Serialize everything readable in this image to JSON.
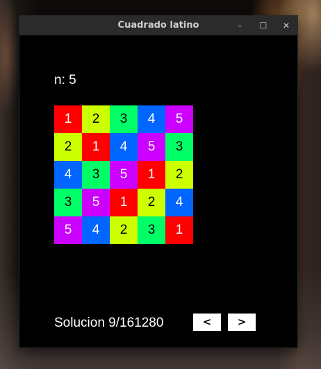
{
  "window": {
    "title": "Cuadrado latino",
    "controls": {
      "minimize": "–",
      "maximize": "☐",
      "close": "✕"
    }
  },
  "n_label": "n: 5",
  "colors": {
    "1": "#ff0000",
    "2": "#ccff00",
    "3": "#00ff66",
    "4": "#0066ff",
    "5": "#cc00ff"
  },
  "text_colors": {
    "1": "#ffffff",
    "2": "#000000",
    "3": "#000000",
    "4": "#ffffff",
    "5": "#ffffff"
  },
  "grid": [
    [
      "1",
      "2",
      "3",
      "4",
      "5"
    ],
    [
      "2",
      "1",
      "4",
      "5",
      "3"
    ],
    [
      "4",
      "3",
      "5",
      "1",
      "2"
    ],
    [
      "3",
      "5",
      "1",
      "2",
      "4"
    ],
    [
      "5",
      "4",
      "2",
      "3",
      "1"
    ]
  ],
  "solution_label": "Solucion 9/161280",
  "nav": {
    "prev": "<",
    "next": ">"
  }
}
